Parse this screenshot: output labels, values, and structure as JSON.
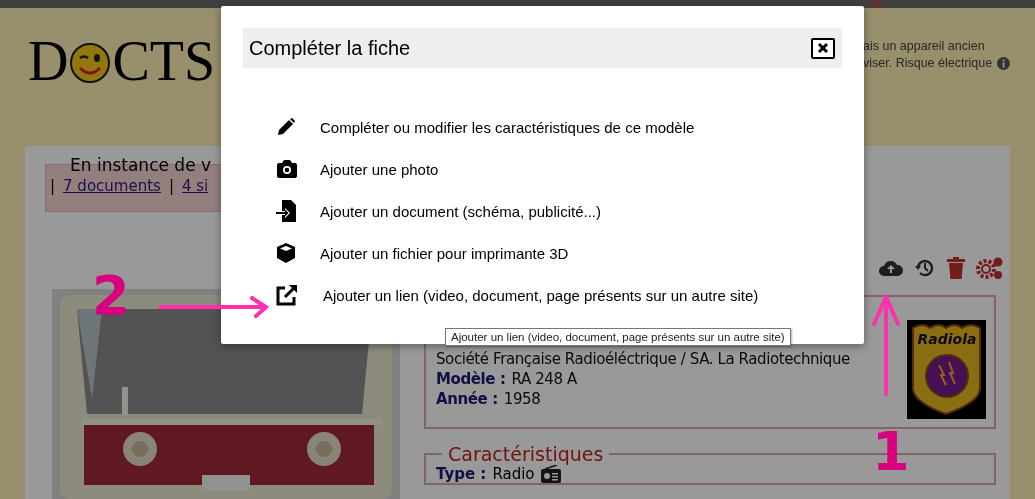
{
  "logo": {
    "lead": "D",
    "rest": "CTS"
  },
  "header_notice": [
    "ais un appareil ancien",
    "viser. Risque électrique"
  ],
  "notice": {
    "title": "En instance de v",
    "separator": "|",
    "links": [
      "7 documents",
      "4 si"
    ]
  },
  "info": {
    "maker": "Société Française Radioéléctrique / SA. La Radiotechnique",
    "fields": [
      {
        "label": "Modèle :",
        "value": "RA 248 A"
      },
      {
        "label": "Année :",
        "value": "1958"
      }
    ],
    "brand": "Radiola"
  },
  "characteristics": {
    "legend": "Caractéristiques",
    "fields": [
      {
        "label": "Type :",
        "value": "Radio"
      }
    ]
  },
  "modal": {
    "title": "Compléter la fiche",
    "actions": [
      {
        "kind": "edit",
        "label": "Compléter ou modifier les caractéristiques de ce modèle"
      },
      {
        "label": "Ajouter une photo"
      },
      {
        "kind": "document",
        "label": "Ajouter un document (schéma, publicité...)"
      },
      {
        "kind": "print3d",
        "label": "Ajouter un fichier pour imprimante 3D"
      },
      {
        "kind": "link",
        "label": "Ajouter un lien (video, document, page présents sur un autre site)"
      }
    ]
  },
  "tooltip": "Ajouter un lien (video, document, page présents sur un autre site)",
  "annotations": [
    {
      "label": "2"
    },
    {
      "label": "1"
    }
  ]
}
